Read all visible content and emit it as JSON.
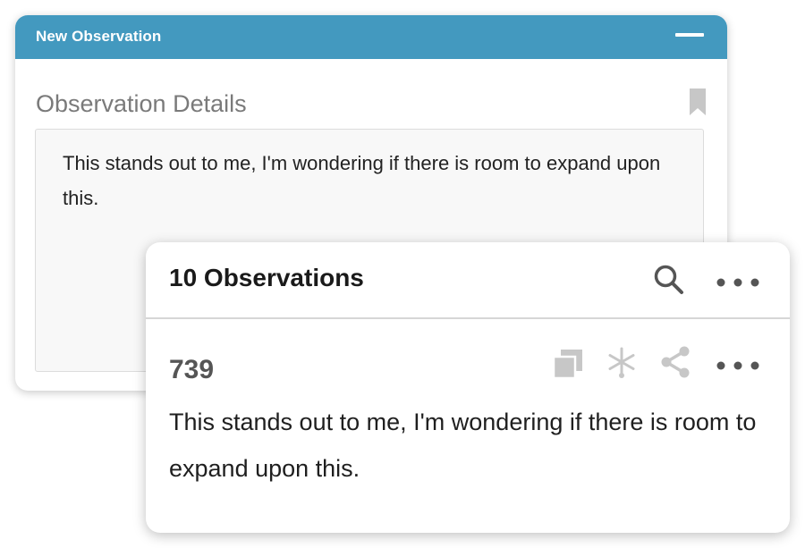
{
  "new_observation": {
    "title": "New Observation",
    "details_heading": "Observation Details",
    "details_text": "This stands out to me, I'm wondering if there is room to expand upon this."
  },
  "observations": {
    "count_label": "10 Observations",
    "items": [
      {
        "id": "739",
        "text": "This stands out to me, I'm wondering if there is room to expand upon this."
      }
    ]
  },
  "icons": {
    "minimize": "minimize-icon",
    "bookmark": "bookmark-icon",
    "search": "search-icon",
    "more": "more-horizontal-icon",
    "copy": "copy-icon",
    "asterisk": "asterisk-icon",
    "share": "share-icon"
  },
  "colors": {
    "header_blue": "#4399bf",
    "icon_gray": "#c7c7c7",
    "dark_icon": "#555555"
  }
}
